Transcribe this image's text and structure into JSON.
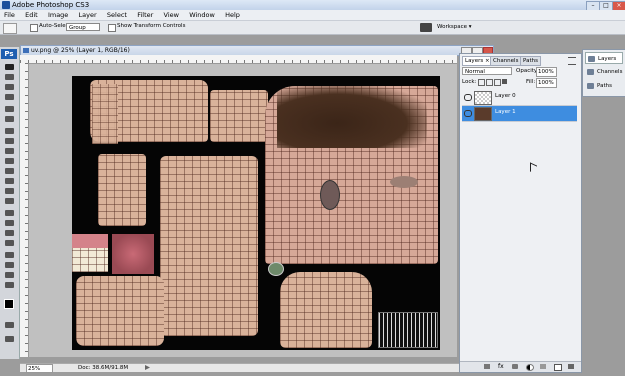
{
  "window": {
    "title": "Adobe Photoshop CS3"
  },
  "menu": [
    "File",
    "Edit",
    "Image",
    "Layer",
    "Select",
    "Filter",
    "View",
    "Window",
    "Help"
  ],
  "options": {
    "auto_select_label": "Auto-Select:",
    "auto_select_value": "Group",
    "show_transform_label": "Show Transform Controls",
    "workspace_label": "Workspace ▾"
  },
  "toolbox": {
    "logo": "Ps"
  },
  "document": {
    "tab_title": "uv.png @ 25% (Layer 1, RGB/16)",
    "zoom": "25%",
    "doc_size": "Doc: 38.6M/91.8M"
  },
  "layers_panel": {
    "tabs": [
      "Layers ×",
      "Channels",
      "Paths"
    ],
    "blend_mode": "Normal",
    "opacity_label": "Opacity:",
    "opacity_value": "100%",
    "lock_label": "Lock:",
    "fill_label": "Fill:",
    "fill_value": "100%",
    "layers": [
      {
        "name": "Layer 0",
        "selected": false
      },
      {
        "name": "Layer 1",
        "selected": true
      }
    ]
  },
  "mini_panel": {
    "items": [
      "Layers",
      "Channels",
      "Paths"
    ]
  },
  "colors": {
    "selection": "#3e8de0",
    "skin": "#d9b29a",
    "canvas": "#050505"
  }
}
